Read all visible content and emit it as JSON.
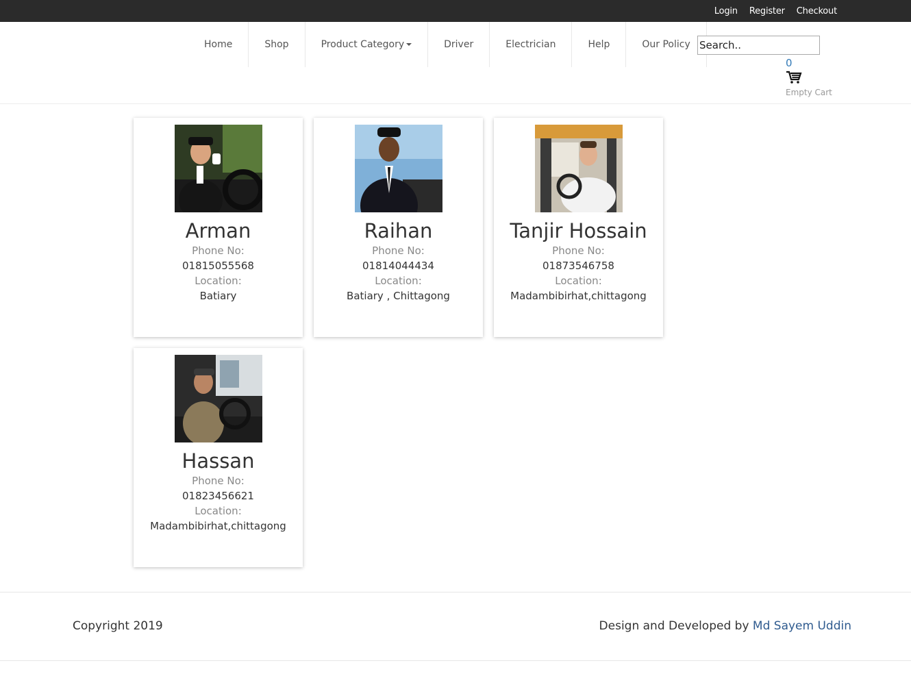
{
  "topbar": {
    "login": "Login",
    "register": "Register",
    "checkout": "Checkout"
  },
  "nav": {
    "items": [
      {
        "label": "Home"
      },
      {
        "label": "Shop"
      },
      {
        "label": "Product Category"
      },
      {
        "label": "Driver"
      },
      {
        "label": "Electrician"
      },
      {
        "label": "Help"
      },
      {
        "label": "Our Policy"
      }
    ],
    "search_placeholder": "Search..",
    "cart_count": "0",
    "cart_status": "Empty Cart"
  },
  "drivers": [
    {
      "name": "Arman",
      "phone_label": "Phone No:",
      "phone": "01815055568",
      "location_label": "Location:",
      "location": "Batiary"
    },
    {
      "name": "Raihan",
      "phone_label": "Phone No:",
      "phone": "01814044434",
      "location_label": "Location:",
      "location": "Batiary , Chittagong"
    },
    {
      "name": "Tanjir Hossain",
      "phone_label": "Phone No:",
      "phone": "01873546758",
      "location_label": "Location:",
      "location": "Madambibirhat,chittagong"
    },
    {
      "name": "Hassan",
      "phone_label": "Phone No:",
      "phone": "01823456621",
      "location_label": "Location:",
      "location": "Madambibirhat,chittagong"
    }
  ],
  "footer": {
    "copyright": "Copyright 2019",
    "credit_prefix": "Design and Developed by ",
    "credit_name": "Md Sayem Uddin"
  },
  "colors": {
    "topbar": "#2b2b2b",
    "link": "#337ab7",
    "credit": "#2f5b8f"
  }
}
